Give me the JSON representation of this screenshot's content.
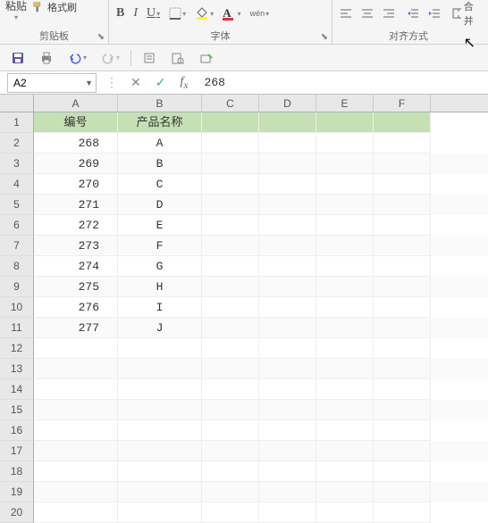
{
  "ribbon": {
    "paste_label": "粘贴",
    "format_painter": "格式刷",
    "clipboard_group": "剪贴板",
    "font_group": "字体",
    "align_group": "对齐方式",
    "merge_label": "合并",
    "wen_label": "wén"
  },
  "name_box": "A2",
  "formula_value": "268",
  "columns": [
    "A",
    "B",
    "C",
    "D",
    "E",
    "F"
  ],
  "header_cells": {
    "A": "编号",
    "B": "产品名称"
  },
  "data_rows": [
    {
      "r": 2,
      "A": "268",
      "B": "A"
    },
    {
      "r": 3,
      "A": "269",
      "B": "B"
    },
    {
      "r": 4,
      "A": "270",
      "B": "C"
    },
    {
      "r": 5,
      "A": "271",
      "B": "D"
    },
    {
      "r": 6,
      "A": "272",
      "B": "E"
    },
    {
      "r": 7,
      "A": "273",
      "B": "F"
    },
    {
      "r": 8,
      "A": "274",
      "B": "G"
    },
    {
      "r": 9,
      "A": "275",
      "B": "H"
    },
    {
      "r": 10,
      "A": "276",
      "B": "I"
    },
    {
      "r": 11,
      "A": "277",
      "B": "J"
    }
  ],
  "empty_rows": [
    12,
    13,
    14,
    15,
    16,
    17,
    18,
    19,
    20
  ]
}
